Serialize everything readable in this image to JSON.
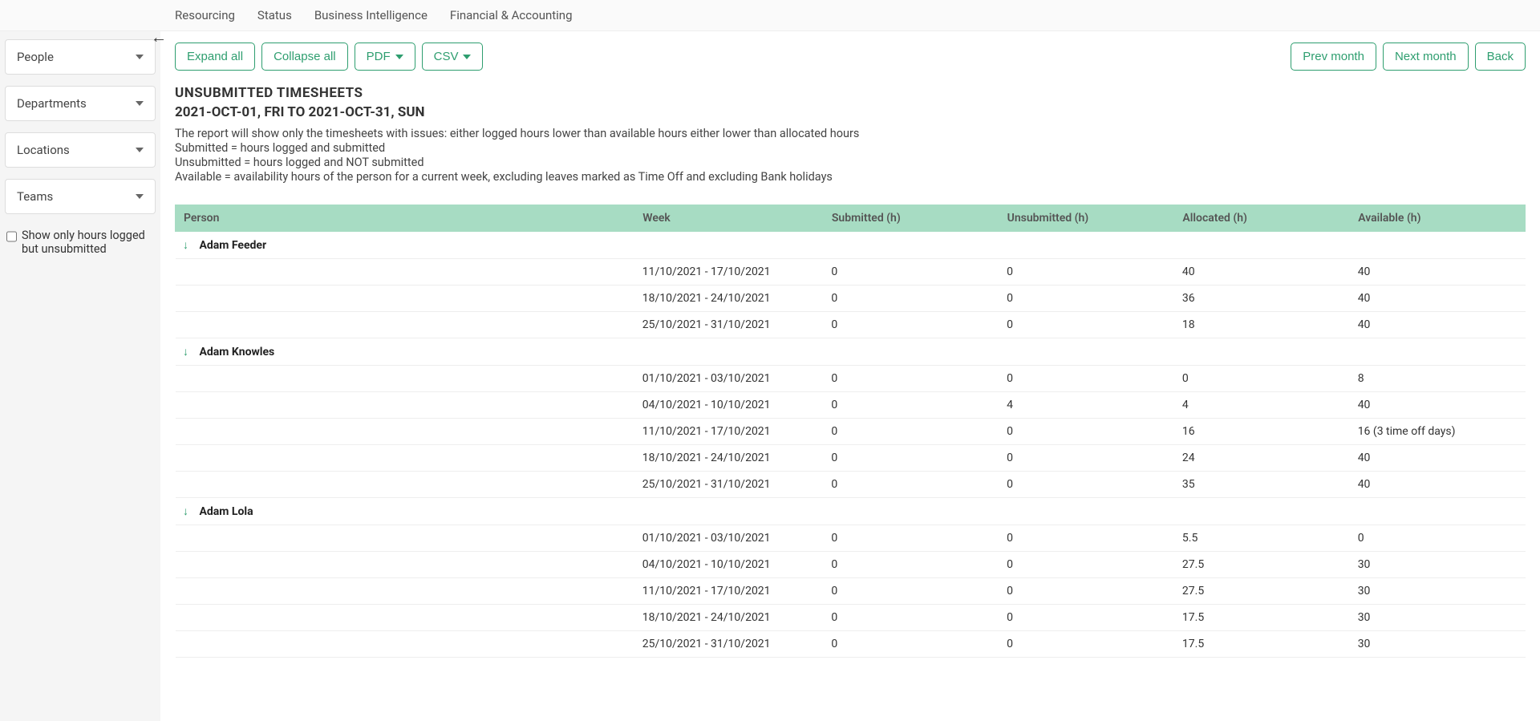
{
  "topTabs": [
    "Resourcing",
    "Status",
    "Business Intelligence",
    "Financial & Accounting"
  ],
  "sidebar": {
    "filters": [
      "People",
      "Departments",
      "Locations",
      "Teams"
    ],
    "checkboxLabel": "Show only hours logged but unsubmitted"
  },
  "toolbar": {
    "expandAll": "Expand all",
    "collapseAll": "Collapse all",
    "pdf": "PDF",
    "csv": "CSV",
    "prevMonth": "Prev month",
    "nextMonth": "Next month",
    "back": "Back"
  },
  "report": {
    "title": "UNSUBMITTED TIMESHEETS",
    "dateRange": "2021-OCT-01, FRI TO 2021-OCT-31, SUN",
    "descLines": [
      "The report will show only the timesheets with issues: either logged hours lower than available hours either lower than allocated hours",
      "Submitted = hours logged and submitted",
      "Unsubmitted = hours logged and NOT submitted",
      "Available = availability hours of the person for a current week, excluding leaves marked as Time Off and excluding Bank holidays"
    ],
    "columns": [
      "Person",
      "Week",
      "Submitted (h)",
      "Unsubmitted (h)",
      "Allocated (h)",
      "Available (h)"
    ],
    "groups": [
      {
        "person": "Adam Feeder",
        "rows": [
          {
            "week": "11/10/2021 - 17/10/2021",
            "submitted": "0",
            "unsubmitted": "0",
            "allocated": "40",
            "available": "40"
          },
          {
            "week": "18/10/2021 - 24/10/2021",
            "submitted": "0",
            "unsubmitted": "0",
            "allocated": "36",
            "available": "40"
          },
          {
            "week": "25/10/2021 - 31/10/2021",
            "submitted": "0",
            "unsubmitted": "0",
            "allocated": "18",
            "available": "40"
          }
        ]
      },
      {
        "person": "Adam Knowles",
        "rows": [
          {
            "week": "01/10/2021 - 03/10/2021",
            "submitted": "0",
            "unsubmitted": "0",
            "allocated": "0",
            "available": "8"
          },
          {
            "week": "04/10/2021 - 10/10/2021",
            "submitted": "0",
            "unsubmitted": "4",
            "allocated": "4",
            "available": "40"
          },
          {
            "week": "11/10/2021 - 17/10/2021",
            "submitted": "0",
            "unsubmitted": "0",
            "allocated": "16",
            "available": "16 (3 time off days)"
          },
          {
            "week": "18/10/2021 - 24/10/2021",
            "submitted": "0",
            "unsubmitted": "0",
            "allocated": "24",
            "available": "40"
          },
          {
            "week": "25/10/2021 - 31/10/2021",
            "submitted": "0",
            "unsubmitted": "0",
            "allocated": "35",
            "available": "40"
          }
        ]
      },
      {
        "person": "Adam Lola",
        "rows": [
          {
            "week": "01/10/2021 - 03/10/2021",
            "submitted": "0",
            "unsubmitted": "0",
            "allocated": "5.5",
            "available": "0"
          },
          {
            "week": "04/10/2021 - 10/10/2021",
            "submitted": "0",
            "unsubmitted": "0",
            "allocated": "27.5",
            "available": "30"
          },
          {
            "week": "11/10/2021 - 17/10/2021",
            "submitted": "0",
            "unsubmitted": "0",
            "allocated": "27.5",
            "available": "30"
          },
          {
            "week": "18/10/2021 - 24/10/2021",
            "submitted": "0",
            "unsubmitted": "0",
            "allocated": "17.5",
            "available": "30"
          },
          {
            "week": "25/10/2021 - 31/10/2021",
            "submitted": "0",
            "unsubmitted": "0",
            "allocated": "17.5",
            "available": "30"
          }
        ]
      }
    ]
  }
}
